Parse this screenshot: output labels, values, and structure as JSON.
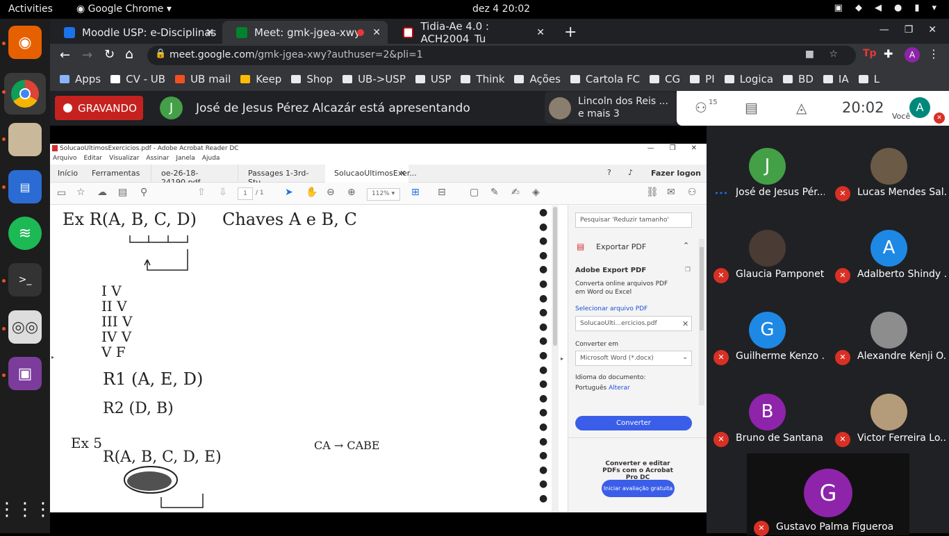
{
  "system": {
    "activities": "Activities",
    "app_menu": "Google Chrome",
    "clock": "dez 4  20:02"
  },
  "browser": {
    "tabs": [
      {
        "label": "Moodle USP: e-Disciplinas"
      },
      {
        "label": "Meet: gmk-jgea-xwy"
      },
      {
        "label": "Tidia-Ae 4.0 : ACH2004_Tu"
      }
    ],
    "url_host": "meet.google.com",
    "url_path": "/gmk-jgea-xwy?authuser=2&pli=1",
    "profile_initial": "A",
    "bookmarks": [
      "Apps",
      "CV - UB",
      "UB mail",
      "Keep",
      "Shop",
      "UB->USP",
      "USP",
      "Think",
      "Ações",
      "Cartola FC",
      "CG",
      "PI",
      "Logica",
      "BD",
      "IA",
      "L"
    ]
  },
  "meet": {
    "recording_label": "GRAVANDO",
    "presenter_initial": "J",
    "presenting_text": "José de Jesus Pérez Alcazár está apresentando",
    "speaker_line1": "Lincoln dos Reis ...",
    "speaker_line2": "e mais 3",
    "participant_count": "15",
    "time": "20:02",
    "you_label": "Você",
    "you_initial": "A"
  },
  "acrobat": {
    "title": "SolucaoUltimosExercicios.pdf - Adobe Acrobat Reader DC",
    "menu": [
      "Arquivo",
      "Editar",
      "Visualizar",
      "Assinar",
      "Janela",
      "Ajuda"
    ],
    "tab_home": "Início",
    "tab_tools": "Ferramentas",
    "doc_tabs": [
      "oe-26-18-24190.pdf",
      "Passages 1-3rd-Stu...",
      "SolucaoUltimosExer..."
    ],
    "login": "Fazer logon",
    "page_current": "1",
    "page_total": "/ 1",
    "zoom": "112%",
    "pane": {
      "search_placeholder": "Pesquisar 'Reduzir tamanho'",
      "export_header": "Exportar PDF",
      "section_title": "Adobe Export PDF",
      "section_desc": "Converta online arquivos PDF em Word ou Excel",
      "select_link": "Selecionar arquivo PDF",
      "file_name": "SolucaoUlti...ercicios.pdf",
      "convert_to_label": "Converter em",
      "format": "Microsoft Word (*.docx)",
      "lang_label": "Idioma do documento:",
      "lang_value": "Português",
      "lang_change": "Alterar",
      "convert_button": "Converter",
      "promo": "Converter e editar PDFs com o Acrobat Pro DC",
      "trial_button": "Iniciar avaliação gratuita"
    }
  },
  "handwriting": {
    "line1": "Ex R(A, B, C, D)",
    "line1b": "Chaves A e B, C",
    "forms": [
      "I V",
      "II V",
      "III V",
      "IV V",
      "V F"
    ],
    "r1": "R1 (A, E, D)",
    "r2": "R2 (D, B)",
    "ex5": "Ex 5",
    "r5": "R(A, B, C, D, E)",
    "fd": "CA → CABE"
  },
  "participants": [
    {
      "name": "José de Jesus Pér...",
      "initial": "J",
      "color": "#43a047",
      "muted": false
    },
    {
      "name": "Lucas Mendes Sal...",
      "initial": "",
      "color": "#6b5a46",
      "muted": true
    },
    {
      "name": "Glaucia Pamponet...",
      "initial": "",
      "color": "#4a3b35",
      "muted": true
    },
    {
      "name": "Adalberto Shindy ...",
      "initial": "A",
      "color": "#1e88e5",
      "muted": true
    },
    {
      "name": "Guilherme Kenzo ...",
      "initial": "G",
      "color": "#1e88e5",
      "muted": true
    },
    {
      "name": "Alexandre Kenji O...",
      "initial": "",
      "color": "#8d8d8d",
      "muted": true
    },
    {
      "name": "Bruno de Santana ...",
      "initial": "B",
      "color": "#8e24aa",
      "muted": true
    },
    {
      "name": "Victor Ferreira Lo...",
      "initial": "",
      "color": "#b49b7a",
      "muted": true
    },
    {
      "name": "Gustavo Palma Figueroa",
      "initial": "G",
      "color": "#8e24aa",
      "muted": true
    }
  ]
}
